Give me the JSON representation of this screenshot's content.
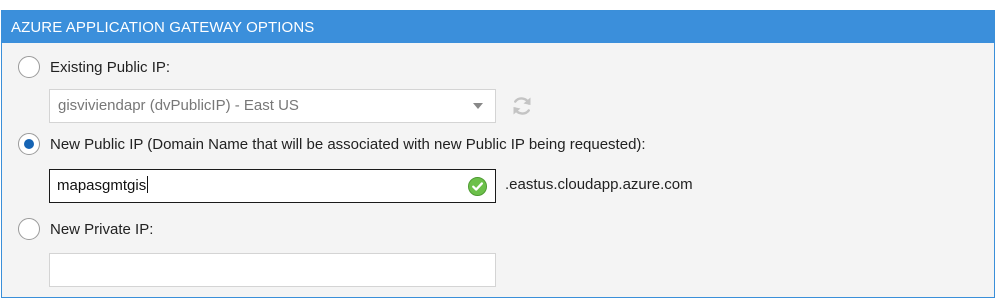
{
  "panel": {
    "title": "AZURE APPLICATION GATEWAY OPTIONS"
  },
  "options": {
    "existing_public_ip": {
      "label": "Existing Public IP:",
      "checked": false,
      "selected_value": "gisviviendapr (dvPublicIP) - East US"
    },
    "new_public_ip": {
      "label": "New Public IP (Domain Name that will be associated with new Public IP being requested):",
      "checked": true,
      "value": "mapasgmtgis",
      "suffix": ".eastus.cloudapp.azure.com",
      "valid": true
    },
    "new_private_ip": {
      "label": "New Private IP:",
      "checked": false,
      "value": ""
    }
  },
  "icons": {
    "refresh": "refresh-icon",
    "valid": "check-circle-icon",
    "dropdown": "chevron-down-icon"
  },
  "colors": {
    "header_bg": "#3b8fdb",
    "radio_selected": "#1664b4",
    "valid_green": "#6cc04a"
  }
}
